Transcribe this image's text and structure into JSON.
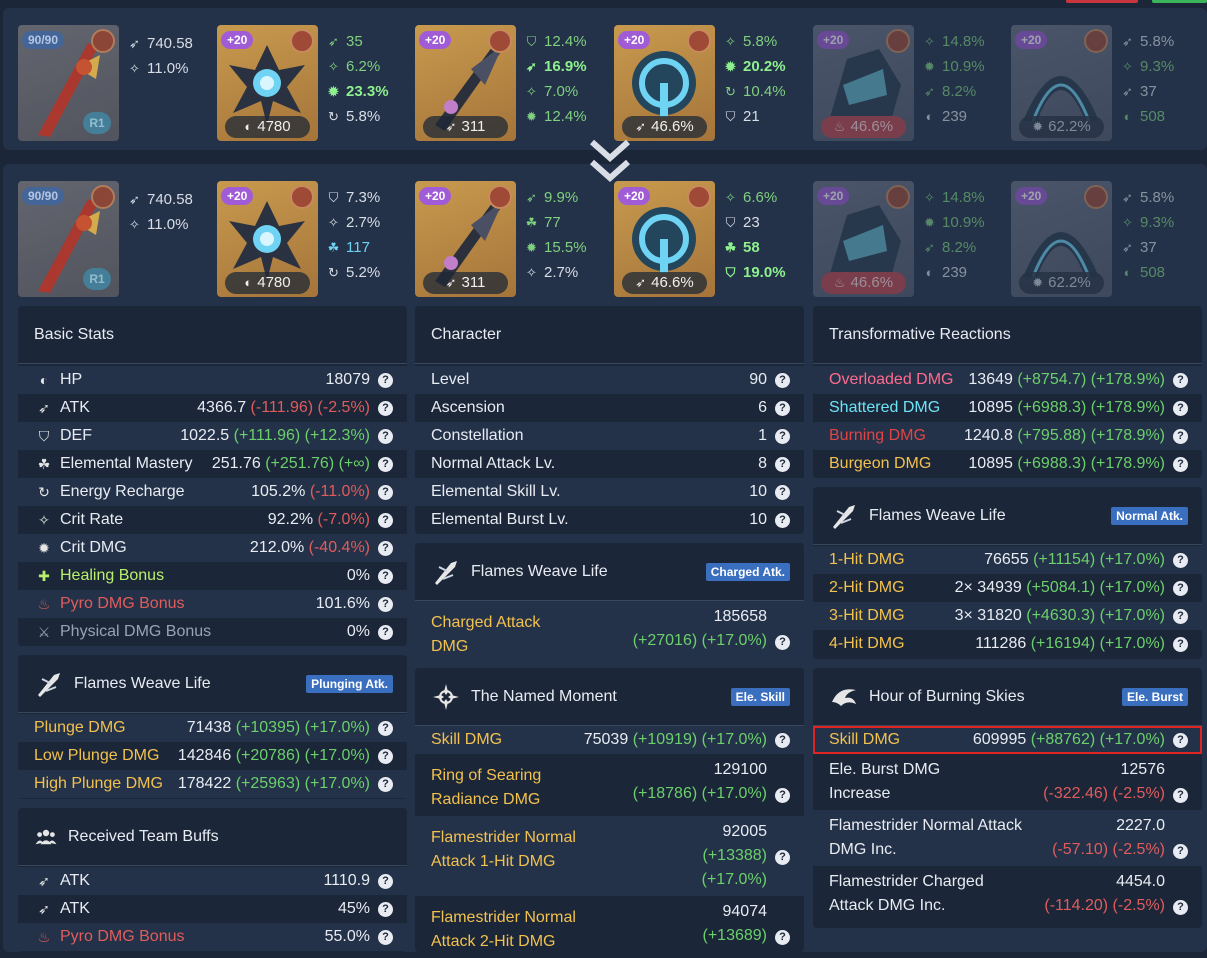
{
  "top_equipment": {
    "weapon": {
      "level": "90/90",
      "refine": "R1",
      "stats": [
        {
          "icon": "atk",
          "value": "740.58"
        },
        {
          "icon": "crit-rate",
          "value": "11.0%"
        }
      ]
    },
    "artifacts": [
      {
        "level": "+20",
        "main": "4780",
        "main_icon": "hp",
        "subs": [
          {
            "icon": "atk",
            "value": "35",
            "color": "g"
          },
          {
            "icon": "crit-rate",
            "value": "6.2%",
            "color": "g"
          },
          {
            "icon": "crit-dmg",
            "value": "23.3%",
            "color": "gb"
          },
          {
            "icon": "energy",
            "value": "5.8%",
            "color": "w"
          }
        ]
      },
      {
        "level": "+20",
        "main": "311",
        "main_icon": "atk",
        "subs": [
          {
            "icon": "def",
            "value": "12.4%",
            "color": "g"
          },
          {
            "icon": "atk",
            "value": "16.9%",
            "color": "gb"
          },
          {
            "icon": "crit-rate",
            "value": "7.0%",
            "color": "g"
          },
          {
            "icon": "crit-dmg",
            "value": "12.4%",
            "color": "g"
          }
        ]
      },
      {
        "level": "+20",
        "main": "46.6%",
        "main_icon": "atk",
        "subs": [
          {
            "icon": "crit-rate",
            "value": "5.8%",
            "color": "g"
          },
          {
            "icon": "crit-dmg",
            "value": "20.2%",
            "color": "gb"
          },
          {
            "icon": "energy",
            "value": "10.4%",
            "color": "g"
          },
          {
            "icon": "def",
            "value": "21",
            "color": "w"
          }
        ]
      },
      {
        "level": "+20",
        "main": "46.6%",
        "main_icon": "pyro",
        "subs": [
          {
            "icon": "crit-rate",
            "value": "14.8%",
            "color": "g"
          },
          {
            "icon": "crit-dmg",
            "value": "10.9%",
            "color": "g"
          },
          {
            "icon": "atk",
            "value": "8.2%",
            "color": "g"
          },
          {
            "icon": "hp",
            "value": "239",
            "color": "w"
          }
        ]
      },
      {
        "level": "+20",
        "main": "62.2%",
        "main_icon": "crit-dmg",
        "subs": [
          {
            "icon": "atk",
            "value": "5.8%",
            "color": "w"
          },
          {
            "icon": "crit-rate",
            "value": "9.3%",
            "color": "g"
          },
          {
            "icon": "atk",
            "value": "37",
            "color": "w"
          },
          {
            "icon": "hp",
            "value": "508",
            "color": "g"
          }
        ]
      }
    ]
  },
  "bottom_equipment": {
    "weapon": {
      "level": "90/90",
      "refine": "R1",
      "stats": [
        {
          "icon": "atk",
          "value": "740.58"
        },
        {
          "icon": "crit-rate",
          "value": "11.0%"
        }
      ]
    },
    "artifacts": [
      {
        "level": "+20",
        "main": "4780",
        "main_icon": "hp",
        "subs": [
          {
            "icon": "def",
            "value": "7.3%",
            "color": "w"
          },
          {
            "icon": "crit-rate",
            "value": "2.7%",
            "color": "w"
          },
          {
            "icon": "em",
            "value": "117",
            "color": "c"
          },
          {
            "icon": "energy",
            "value": "5.2%",
            "color": "w"
          }
        ]
      },
      {
        "level": "+20",
        "main": "311",
        "main_icon": "atk",
        "subs": [
          {
            "icon": "atk",
            "value": "9.9%",
            "color": "g"
          },
          {
            "icon": "em",
            "value": "77",
            "color": "g"
          },
          {
            "icon": "crit-dmg",
            "value": "15.5%",
            "color": "g"
          },
          {
            "icon": "crit-rate",
            "value": "2.7%",
            "color": "w"
          }
        ]
      },
      {
        "level": "+20",
        "main": "46.6%",
        "main_icon": "atk",
        "subs": [
          {
            "icon": "crit-rate",
            "value": "6.6%",
            "color": "g"
          },
          {
            "icon": "def",
            "value": "23",
            "color": "w"
          },
          {
            "icon": "em",
            "value": "58",
            "color": "gb"
          },
          {
            "icon": "def",
            "value": "19.0%",
            "color": "gb"
          }
        ]
      },
      {
        "level": "+20",
        "main": "46.6%",
        "main_icon": "pyro",
        "subs": [
          {
            "icon": "crit-rate",
            "value": "14.8%",
            "color": "g"
          },
          {
            "icon": "crit-dmg",
            "value": "10.9%",
            "color": "g"
          },
          {
            "icon": "atk",
            "value": "8.2%",
            "color": "g"
          },
          {
            "icon": "hp",
            "value": "239",
            "color": "w"
          }
        ]
      },
      {
        "level": "+20",
        "main": "62.2%",
        "main_icon": "crit-dmg",
        "subs": [
          {
            "icon": "atk",
            "value": "5.8%",
            "color": "w"
          },
          {
            "icon": "crit-rate",
            "value": "9.3%",
            "color": "g"
          },
          {
            "icon": "atk",
            "value": "37",
            "color": "w"
          },
          {
            "icon": "hp",
            "value": "508",
            "color": "g"
          }
        ]
      }
    ]
  },
  "basic_stats": {
    "title": "Basic Stats",
    "rows": [
      {
        "icon": "hp",
        "label": "HP",
        "value": "18079",
        "delta": ""
      },
      {
        "icon": "atk",
        "label": "ATK",
        "value": "4366.7",
        "delta": "(-111.96) (-2.5%)",
        "delta_color": "r"
      },
      {
        "icon": "def",
        "label": "DEF",
        "value": "1022.5",
        "delta": "(+111.96) (+12.3%)",
        "delta_color": "g"
      },
      {
        "icon": "em",
        "label": "Elemental Mastery",
        "value": "251.76",
        "delta": "(+251.76) (+∞)",
        "delta_color": "g"
      },
      {
        "icon": "energy",
        "label": "Energy Recharge",
        "value": "105.2%",
        "delta": "(-11.0%)",
        "delta_color": "r"
      },
      {
        "icon": "crit-rate",
        "label": "Crit Rate",
        "value": "92.2%",
        "delta": "(-7.0%)",
        "delta_color": "r"
      },
      {
        "icon": "crit-dmg",
        "label": "Crit DMG",
        "value": "212.0%",
        "delta": "(-40.4%)",
        "delta_color": "r"
      },
      {
        "icon": "heal",
        "label": "Healing Bonus",
        "value": "0%",
        "delta": "",
        "label_color": "lime"
      },
      {
        "icon": "pyro",
        "label": "Pyro DMG Bonus",
        "value": "101.6%",
        "delta": "",
        "label_color": "red"
      },
      {
        "icon": "physical",
        "label": "Physical DMG Bonus",
        "value": "0%",
        "delta": "",
        "label_color": "gray"
      }
    ]
  },
  "plunging": {
    "title": "Flames Weave Life",
    "tag": "Plunging Atk.",
    "rows": [
      {
        "label": "Plunge DMG",
        "value": "71438",
        "delta": "(+10395) (+17.0%)"
      },
      {
        "label": "Low Plunge DMG",
        "value": "142846",
        "delta": "(+20786) (+17.0%)"
      },
      {
        "label": "High Plunge DMG",
        "value": "178422",
        "delta": "(+25963) (+17.0%)"
      }
    ]
  },
  "team_buffs": {
    "title": "Received Team Buffs",
    "rows": [
      {
        "icon": "atk",
        "label": "ATK",
        "value": "1110.9"
      },
      {
        "icon": "atk",
        "label": "ATK",
        "value": "45%"
      },
      {
        "icon": "pyro",
        "label": "Pyro DMG Bonus",
        "value": "55.0%",
        "label_color": "red"
      }
    ]
  },
  "character": {
    "title": "Character",
    "rows": [
      {
        "label": "Level",
        "value": "90"
      },
      {
        "label": "Ascension",
        "value": "6"
      },
      {
        "label": "Constellation",
        "value": "1"
      },
      {
        "label": "Normal Attack Lv.",
        "value": "8"
      },
      {
        "label": "Elemental Skill Lv.",
        "value": "10"
      },
      {
        "label": "Elemental Burst Lv.",
        "value": "10"
      }
    ]
  },
  "charged": {
    "title": "Flames Weave Life",
    "tag": "Charged Atk.",
    "rows": [
      {
        "label_lines": [
          "Charged Attack",
          "DMG"
        ],
        "value": "185658",
        "delta": "(+27016) (+17.0%)"
      }
    ]
  },
  "skill": {
    "title": "The Named Moment",
    "tag": "Ele. Skill",
    "rows": [
      {
        "label": "Skill DMG",
        "value": "75039",
        "delta": "(+10919) (+17.0%)"
      }
    ],
    "multi": [
      {
        "label_lines": [
          "Ring of Searing",
          "Radiance DMG"
        ],
        "value_lines": [
          "129100",
          "(+18786) (+17.0%)"
        ]
      },
      {
        "label_lines": [
          "Flamestrider Normal",
          "Attack 1-Hit DMG"
        ],
        "value_lines": [
          "92005",
          "(+13388)",
          "(+17.0%)"
        ]
      },
      {
        "label_lines": [
          "Flamestrider Normal",
          "Attack 2-Hit DMG"
        ],
        "value_lines": [
          "94074",
          "(+13689)"
        ]
      }
    ]
  },
  "transformative": {
    "title": "Transformative Reactions",
    "rows": [
      {
        "label": "Overloaded DMG",
        "value": "13649",
        "delta": "(+8754.7) (+178.9%)",
        "label_color": "pink"
      },
      {
        "label": "Shattered DMG",
        "value": "10895",
        "delta": "(+6988.3) (+178.9%)",
        "label_color": "cyan"
      },
      {
        "label": "Burning DMG",
        "value": "1240.8",
        "delta": "(+795.88) (+178.9%)",
        "label_color": "burn"
      },
      {
        "label": "Burgeon DMG",
        "value": "10895",
        "delta": "(+6988.3) (+178.9%)",
        "label_color": "burgeon"
      }
    ]
  },
  "normal": {
    "title": "Flames Weave Life",
    "tag": "Normal Atk.",
    "rows": [
      {
        "label": "1-Hit DMG",
        "value": "76655",
        "delta": "(+11154) (+17.0%)"
      },
      {
        "label": "2-Hit DMG",
        "value": "2× 34939",
        "delta": "(+5084.1) (+17.0%)"
      },
      {
        "label": "3-Hit DMG",
        "value": "3× 31820",
        "delta": "(+4630.3) (+17.0%)"
      },
      {
        "label": "4-Hit DMG",
        "value": "111286",
        "delta": "(+16194) (+17.0%)"
      }
    ]
  },
  "burst": {
    "title": "Hour of Burning Skies",
    "tag": "Ele. Burst",
    "rows": [
      {
        "label": "Skill DMG",
        "value": "609995",
        "delta": "(+88762) (+17.0%)"
      }
    ],
    "multi": [
      {
        "label_lines": [
          "Ele. Burst DMG",
          "Increase"
        ],
        "value_lines": [
          "12576",
          "(-322.46) (-2.5%)"
        ]
      },
      {
        "label_lines": [
          "Flamestrider Normal Attack",
          "DMG Inc."
        ],
        "value_lines": [
          "2227.0",
          "(-57.10) (-2.5%)"
        ]
      },
      {
        "label_lines": [
          "Flamestrider Charged",
          "Attack DMG Inc."
        ],
        "value_lines": [
          "4454.0",
          "(-114.20) (-2.5%)"
        ]
      }
    ]
  },
  "help_glyph": "?",
  "colors": {
    "bg": "#1b2638",
    "panel_alt": "#243249",
    "gold": "#f2c14e",
    "green": "#6bd06b",
    "red": "#e05c5c",
    "tag": "#3a6fc0"
  }
}
